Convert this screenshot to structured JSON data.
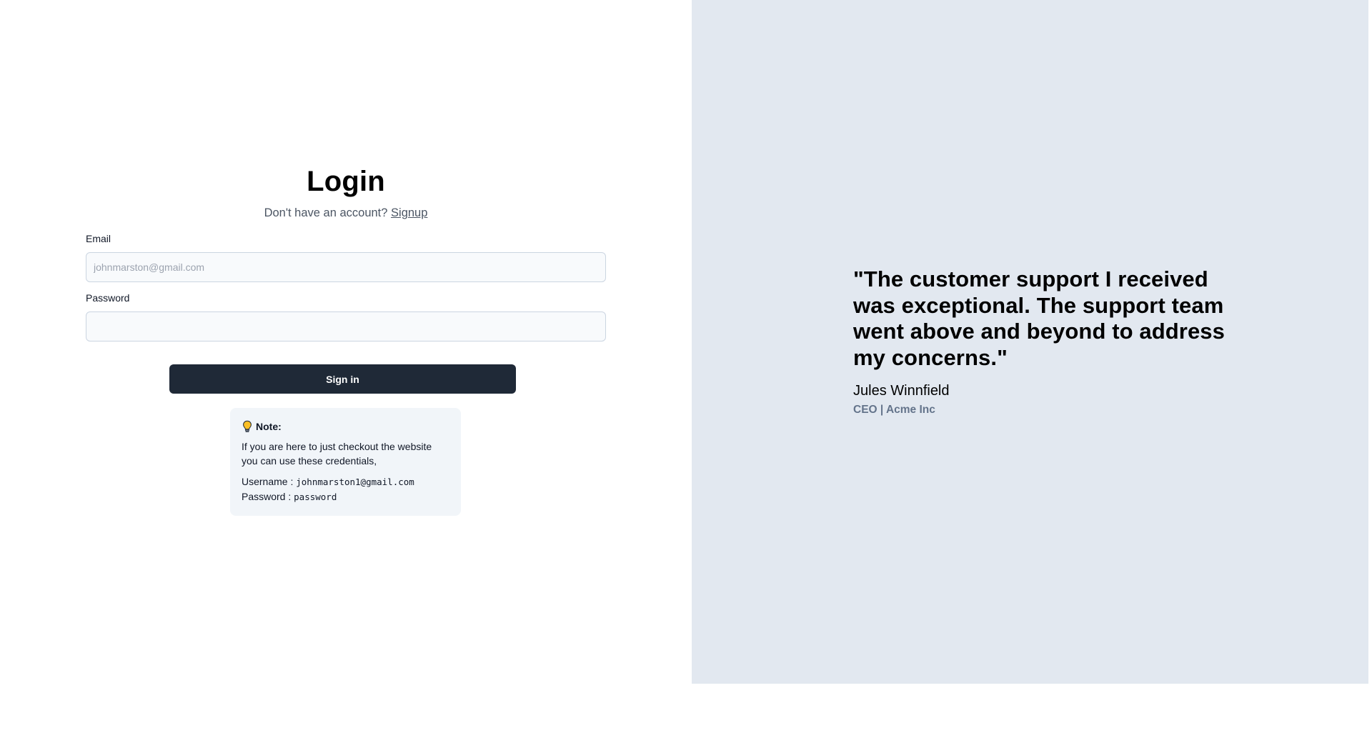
{
  "login": {
    "title": "Login",
    "signup_prompt": "Don't have an account?",
    "signup_link": "Signup",
    "email_label": "Email",
    "email_placeholder": "johnmarston@gmail.com",
    "password_label": "Password",
    "password_value": "",
    "sign_in_label": "Sign in"
  },
  "note": {
    "icon": "lightbulb-icon",
    "title": "Note:",
    "body": "If you are here to just checkout the website you can use these credentials,",
    "username_label": "Username :",
    "username_value": "johnmarston1@gmail.com",
    "password_label": "Password :",
    "password_value": "password"
  },
  "testimonial": {
    "quote": "\"The customer support I received was exceptional. The support team went above and beyond to address my concerns.\"",
    "author": "Jules Winnfield",
    "role": "CEO | Acme Inc"
  },
  "colors": {
    "button_background": "#1f2937",
    "testimonial_background": "#e2e8f0",
    "note_background": "#f1f5f9",
    "bulb_yellow": "#fbbf24"
  }
}
